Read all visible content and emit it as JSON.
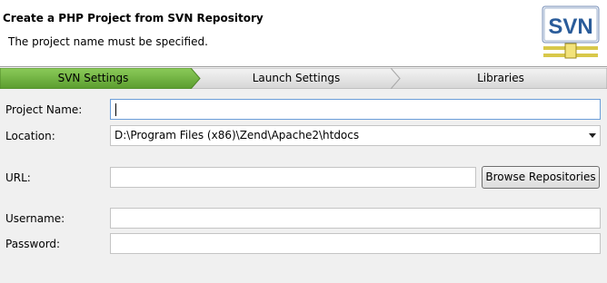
{
  "header": {
    "title": "Create a PHP Project from SVN Repository",
    "message": "The project name must be specified.",
    "logo_text": "SVN"
  },
  "tabs": [
    {
      "label": "SVN Settings",
      "active": true
    },
    {
      "label": "Launch Settings",
      "active": false
    },
    {
      "label": "Libraries",
      "active": false
    }
  ],
  "form": {
    "project_name": {
      "label": "Project Name:",
      "value": ""
    },
    "location": {
      "label": "Location:",
      "value": "D:\\Program Files (x86)\\Zend\\Apache2\\htdocs"
    },
    "url": {
      "label": "URL:",
      "value": ""
    },
    "browse_button": "Browse Repositories",
    "username": {
      "label": "Username:",
      "value": ""
    },
    "password": {
      "label": "Password:",
      "value": ""
    }
  },
  "colors": {
    "active_tab": "#6aae3a",
    "inactive_tab": "#e3e3e3",
    "focus_border": "#6b9ed9"
  }
}
